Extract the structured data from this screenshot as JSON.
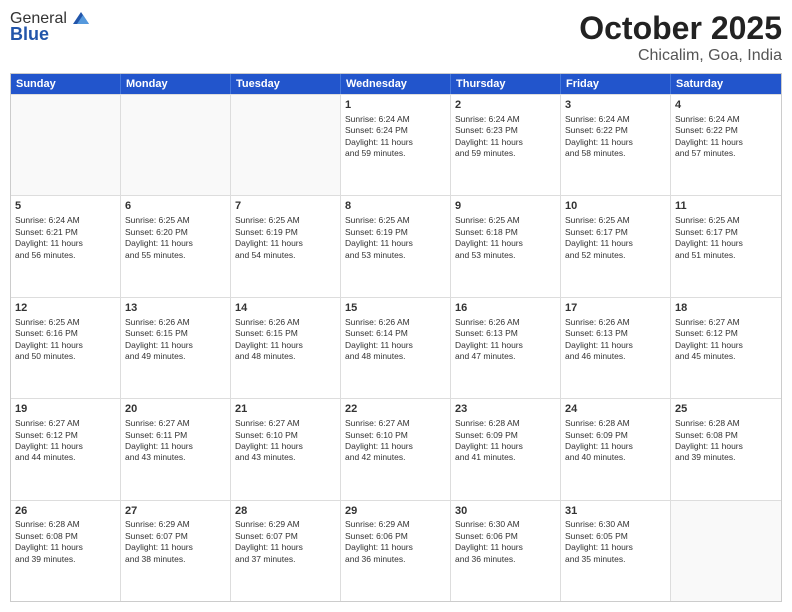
{
  "header": {
    "logo_general": "General",
    "logo_blue": "Blue",
    "month_year": "October 2025",
    "location": "Chicalim, Goa, India"
  },
  "weekdays": [
    "Sunday",
    "Monday",
    "Tuesday",
    "Wednesday",
    "Thursday",
    "Friday",
    "Saturday"
  ],
  "rows": [
    [
      {
        "day": "",
        "info": ""
      },
      {
        "day": "",
        "info": ""
      },
      {
        "day": "",
        "info": ""
      },
      {
        "day": "1",
        "info": "Sunrise: 6:24 AM\nSunset: 6:24 PM\nDaylight: 11 hours\nand 59 minutes."
      },
      {
        "day": "2",
        "info": "Sunrise: 6:24 AM\nSunset: 6:23 PM\nDaylight: 11 hours\nand 59 minutes."
      },
      {
        "day": "3",
        "info": "Sunrise: 6:24 AM\nSunset: 6:22 PM\nDaylight: 11 hours\nand 58 minutes."
      },
      {
        "day": "4",
        "info": "Sunrise: 6:24 AM\nSunset: 6:22 PM\nDaylight: 11 hours\nand 57 minutes."
      }
    ],
    [
      {
        "day": "5",
        "info": "Sunrise: 6:24 AM\nSunset: 6:21 PM\nDaylight: 11 hours\nand 56 minutes."
      },
      {
        "day": "6",
        "info": "Sunrise: 6:25 AM\nSunset: 6:20 PM\nDaylight: 11 hours\nand 55 minutes."
      },
      {
        "day": "7",
        "info": "Sunrise: 6:25 AM\nSunset: 6:19 PM\nDaylight: 11 hours\nand 54 minutes."
      },
      {
        "day": "8",
        "info": "Sunrise: 6:25 AM\nSunset: 6:19 PM\nDaylight: 11 hours\nand 53 minutes."
      },
      {
        "day": "9",
        "info": "Sunrise: 6:25 AM\nSunset: 6:18 PM\nDaylight: 11 hours\nand 53 minutes."
      },
      {
        "day": "10",
        "info": "Sunrise: 6:25 AM\nSunset: 6:17 PM\nDaylight: 11 hours\nand 52 minutes."
      },
      {
        "day": "11",
        "info": "Sunrise: 6:25 AM\nSunset: 6:17 PM\nDaylight: 11 hours\nand 51 minutes."
      }
    ],
    [
      {
        "day": "12",
        "info": "Sunrise: 6:25 AM\nSunset: 6:16 PM\nDaylight: 11 hours\nand 50 minutes."
      },
      {
        "day": "13",
        "info": "Sunrise: 6:26 AM\nSunset: 6:15 PM\nDaylight: 11 hours\nand 49 minutes."
      },
      {
        "day": "14",
        "info": "Sunrise: 6:26 AM\nSunset: 6:15 PM\nDaylight: 11 hours\nand 48 minutes."
      },
      {
        "day": "15",
        "info": "Sunrise: 6:26 AM\nSunset: 6:14 PM\nDaylight: 11 hours\nand 48 minutes."
      },
      {
        "day": "16",
        "info": "Sunrise: 6:26 AM\nSunset: 6:13 PM\nDaylight: 11 hours\nand 47 minutes."
      },
      {
        "day": "17",
        "info": "Sunrise: 6:26 AM\nSunset: 6:13 PM\nDaylight: 11 hours\nand 46 minutes."
      },
      {
        "day": "18",
        "info": "Sunrise: 6:27 AM\nSunset: 6:12 PM\nDaylight: 11 hours\nand 45 minutes."
      }
    ],
    [
      {
        "day": "19",
        "info": "Sunrise: 6:27 AM\nSunset: 6:12 PM\nDaylight: 11 hours\nand 44 minutes."
      },
      {
        "day": "20",
        "info": "Sunrise: 6:27 AM\nSunset: 6:11 PM\nDaylight: 11 hours\nand 43 minutes."
      },
      {
        "day": "21",
        "info": "Sunrise: 6:27 AM\nSunset: 6:10 PM\nDaylight: 11 hours\nand 43 minutes."
      },
      {
        "day": "22",
        "info": "Sunrise: 6:27 AM\nSunset: 6:10 PM\nDaylight: 11 hours\nand 42 minutes."
      },
      {
        "day": "23",
        "info": "Sunrise: 6:28 AM\nSunset: 6:09 PM\nDaylight: 11 hours\nand 41 minutes."
      },
      {
        "day": "24",
        "info": "Sunrise: 6:28 AM\nSunset: 6:09 PM\nDaylight: 11 hours\nand 40 minutes."
      },
      {
        "day": "25",
        "info": "Sunrise: 6:28 AM\nSunset: 6:08 PM\nDaylight: 11 hours\nand 39 minutes."
      }
    ],
    [
      {
        "day": "26",
        "info": "Sunrise: 6:28 AM\nSunset: 6:08 PM\nDaylight: 11 hours\nand 39 minutes."
      },
      {
        "day": "27",
        "info": "Sunrise: 6:29 AM\nSunset: 6:07 PM\nDaylight: 11 hours\nand 38 minutes."
      },
      {
        "day": "28",
        "info": "Sunrise: 6:29 AM\nSunset: 6:07 PM\nDaylight: 11 hours\nand 37 minutes."
      },
      {
        "day": "29",
        "info": "Sunrise: 6:29 AM\nSunset: 6:06 PM\nDaylight: 11 hours\nand 36 minutes."
      },
      {
        "day": "30",
        "info": "Sunrise: 6:30 AM\nSunset: 6:06 PM\nDaylight: 11 hours\nand 36 minutes."
      },
      {
        "day": "31",
        "info": "Sunrise: 6:30 AM\nSunset: 6:05 PM\nDaylight: 11 hours\nand 35 minutes."
      },
      {
        "day": "",
        "info": ""
      }
    ]
  ]
}
